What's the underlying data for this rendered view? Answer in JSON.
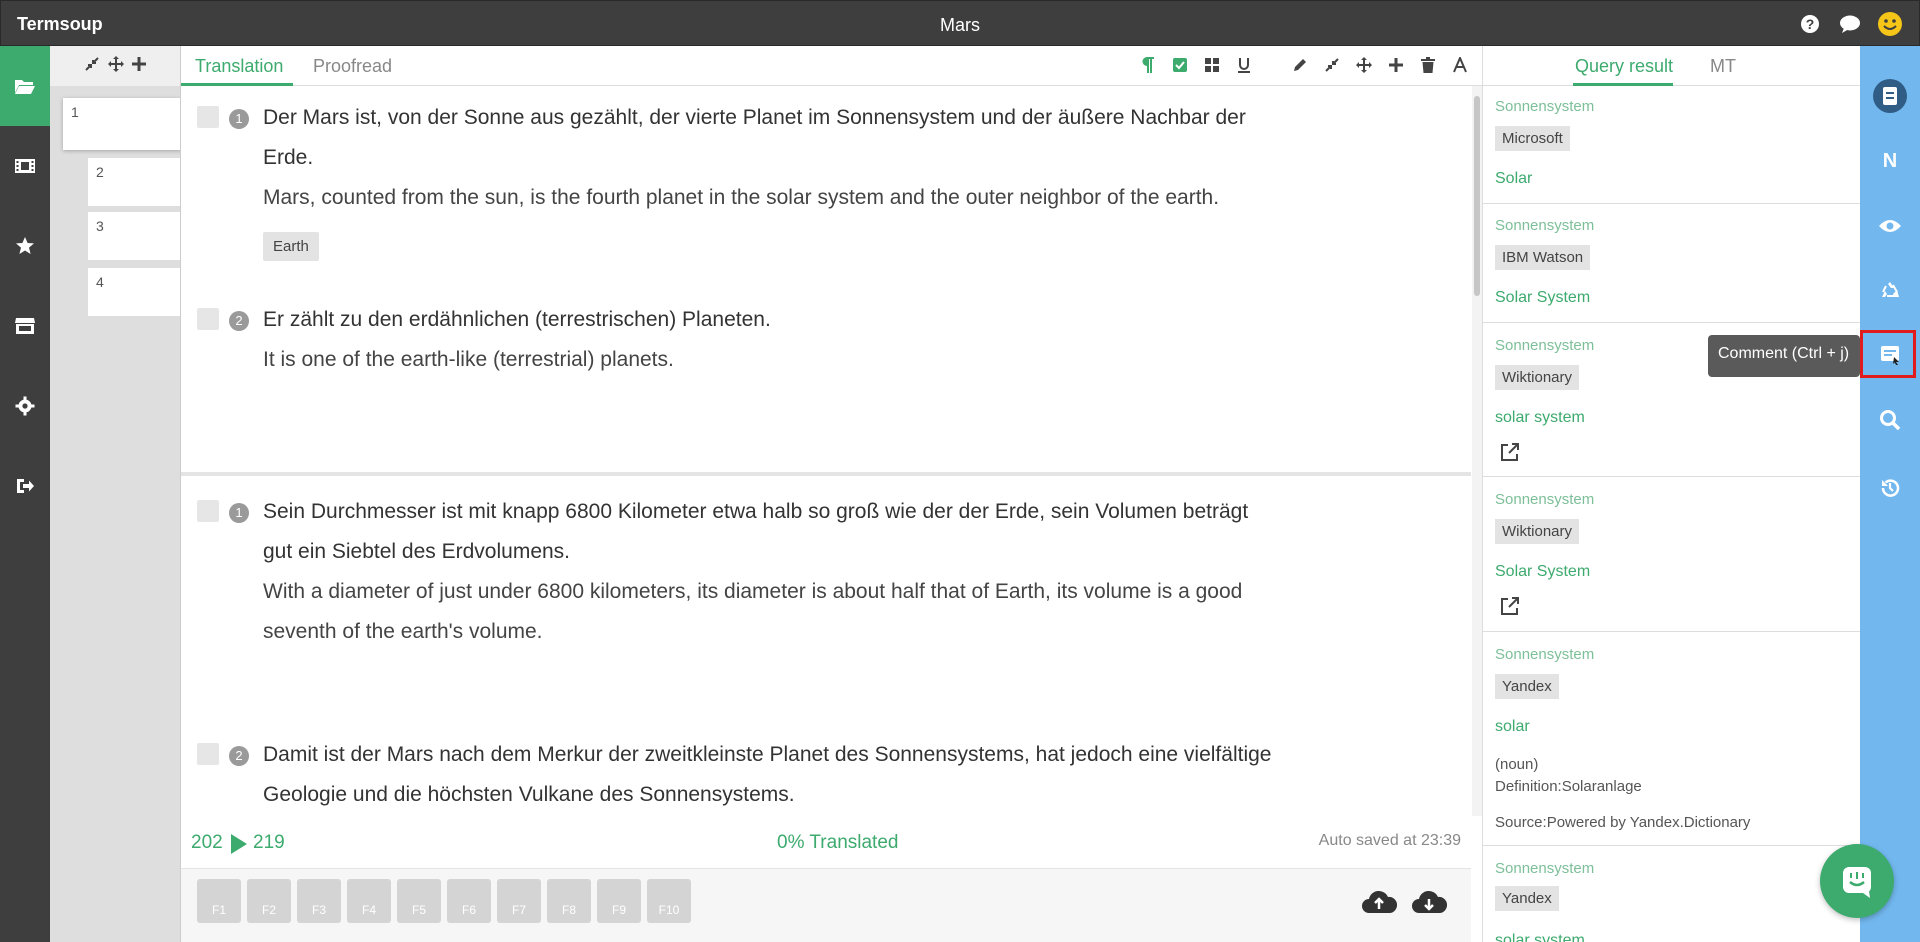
{
  "app": {
    "brand": "Termsoup",
    "doc_title": "Mars"
  },
  "top_icons": [
    "help-icon",
    "chat-icon",
    "smiley-avatar-icon"
  ],
  "left_nav": [
    "folder-open-icon",
    "film-icon",
    "star-icon",
    "store-icon",
    "gear-icon",
    "sign-out-icon"
  ],
  "segment_list": {
    "tools": [
      "compress-icon",
      "move-icon",
      "plus-icon"
    ],
    "items": [
      "1",
      "2",
      "3",
      "4"
    ]
  },
  "editor": {
    "tabs": [
      "Translation",
      "Proofread"
    ],
    "toolbar": [
      "paragraph-icon",
      "check-square-icon",
      "grid-icon",
      "underline-icon",
      "pencil-icon",
      "compress-icon",
      "move-icon",
      "plus-icon",
      "trash-icon",
      "font-icon"
    ],
    "paragraphs": [
      {
        "segments": [
          {
            "num": "1",
            "source": [
              "Der Mars ist, von der Sonne aus gezählt, der vierte Planet im Sonnensystem und der äußere Nachbar der",
              "Erde."
            ],
            "target": [
              "Mars, counted from the sun, is the fourth planet in the solar system and the outer neighbor of the earth."
            ],
            "term": "Earth"
          },
          {
            "num": "2",
            "source": [
              "Er zählt zu den erdähnlichen (terrestrischen) Planeten."
            ],
            "target": [
              "It is one of the earth-like (terrestrial) planets."
            ]
          }
        ]
      },
      {
        "segments": [
          {
            "num": "1",
            "source": [
              "Sein Durchmesser ist mit knapp 6800 Kilometer etwa halb so groß wie der der Erde, sein Volumen beträgt",
              "gut ein Siebtel des Erdvolumens."
            ],
            "target": [
              "With a diameter of just under 6800 kilometers, its diameter is about half that of Earth, its volume is a good",
              "seventh of the earth's volume."
            ]
          },
          {
            "num": "2",
            "source": [
              "Damit ist der Mars nach dem Merkur der zweitkleinste Planet des Sonnensystems, hat jedoch eine vielfältige",
              "Geologie und die höchsten Vulkane des Sonnensystems."
            ],
            "target": []
          }
        ]
      }
    ],
    "status": {
      "count_a": "202",
      "count_b": "219",
      "translated": "0% Translated",
      "autosave": "Auto saved at 23:39"
    },
    "fkeys": [
      "F1",
      "F2",
      "F3",
      "F4",
      "F5",
      "F6",
      "F7",
      "F8",
      "F9",
      "F10"
    ],
    "bottom_icons": [
      "cloud-upload-icon",
      "cloud-download-icon"
    ]
  },
  "query_panel": {
    "tabs": [
      "Query result",
      "MT"
    ],
    "results": [
      {
        "source": "Sonnensystem",
        "provider": "Microsoft",
        "target": "Solar"
      },
      {
        "source": "Sonnensystem",
        "provider": "IBM Watson",
        "target": "Solar System"
      },
      {
        "source": "Sonnensystem",
        "provider": "Wiktionary",
        "target": "solar system",
        "link": true
      },
      {
        "source": "Sonnensystem",
        "provider": "Wiktionary",
        "target": "Solar System",
        "link": true
      },
      {
        "source": "Sonnensystem",
        "provider": "Yandex",
        "target": "solar",
        "pos": "(noun)",
        "definition": "Definition:Solaranlage",
        "source_note": "Source:Powered by Yandex.Dictionary"
      },
      {
        "source": "Sonnensystem",
        "provider": "Yandex",
        "target": "solar system"
      }
    ]
  },
  "icon_strip": [
    "notebook-icon",
    "n-letter-icon",
    "eye-icon",
    "recycle-icon",
    "comment-icon",
    "search-icon",
    "history-icon"
  ],
  "tooltip": "Comment (Ctrl + j)",
  "colors": {
    "accent_green": "#3daa6e",
    "dark_bar": "#3e3e3e",
    "strip_blue": "#72b8ef",
    "highlight_red": "#e01b1b"
  }
}
